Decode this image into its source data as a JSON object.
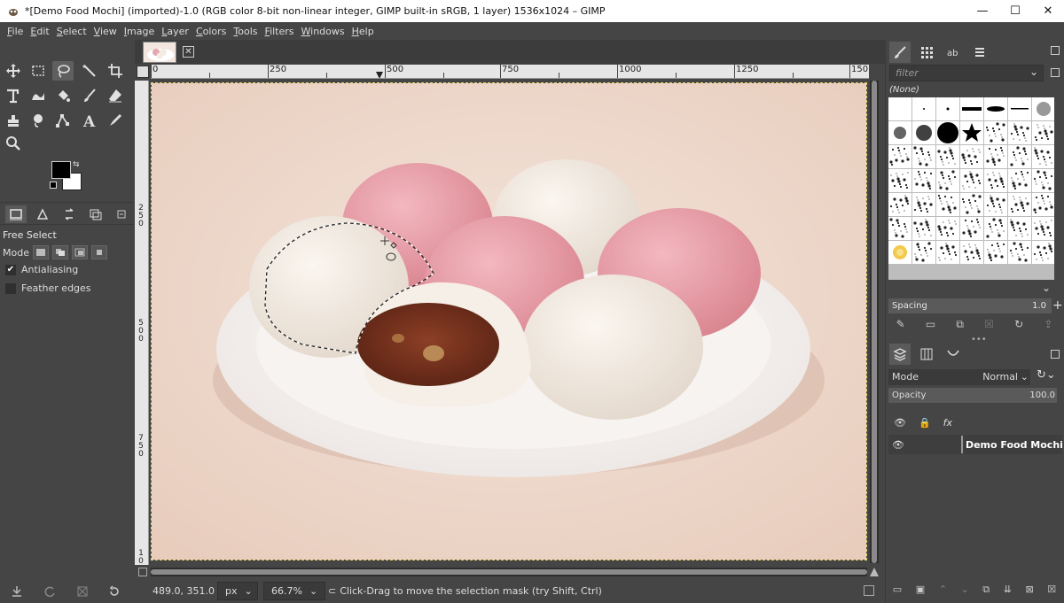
{
  "window": {
    "title": "*[Demo Food Mochi] (imported)-1.0 (RGB color 8-bit non-linear integer, GIMP built-in sRGB, 1 layer) 1536x1024 – GIMP",
    "minimize": "—",
    "maximize": "☐",
    "close": "✕"
  },
  "menu": [
    "File",
    "Edit",
    "Select",
    "View",
    "Image",
    "Layer",
    "Colors",
    "Tools",
    "Filters",
    "Windows",
    "Help"
  ],
  "tool_options": {
    "title": "Free Select",
    "mode_label": "Mode",
    "antialiasing": "Antialiasing",
    "antialiasing_checked": true,
    "feather": "Feather edges",
    "feather_checked": false
  },
  "ruler": {
    "h_labels": [
      "0",
      "250",
      "500",
      "750",
      "1000",
      "1250",
      "150"
    ],
    "v_labels": [
      "2",
      "5",
      "0",
      "5",
      "0",
      "0",
      "7",
      "5",
      "0",
      "1",
      "0"
    ]
  },
  "status": {
    "coords": "489.0, 351.0",
    "unit": "px",
    "zoom": "66.7%",
    "message": "Click-Drag to move the selection mask (try Shift, Ctrl)"
  },
  "brushes": {
    "filter_placeholder": "filter",
    "selected": "(None)",
    "spacing_label": "Spacing",
    "spacing_value": "1.0"
  },
  "layers": {
    "mode_label": "Mode",
    "mode_value": "Normal",
    "opacity_label": "Opacity",
    "opacity_value": "100.0",
    "items": [
      {
        "name": "Demo Food Mochi"
      }
    ]
  },
  "colors": {
    "accent": "#5a5a5a",
    "fg": "#000000",
    "bg": "#ffffff",
    "selection_border": "#e8d36a"
  }
}
